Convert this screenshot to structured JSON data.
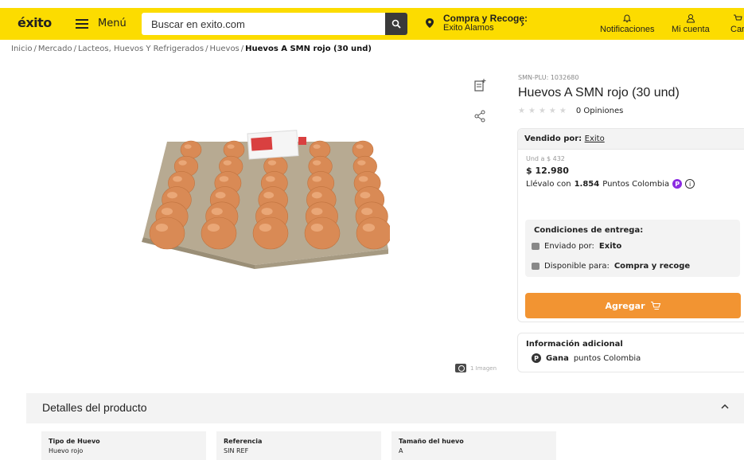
{
  "header": {
    "logo": "éxito",
    "menu_label": "Menú",
    "search_placeholder": "Buscar en exito.com",
    "pickup_title": "Compra y Recoge:",
    "pickup_store": "Exito Alamos",
    "notifications": "Notificaciones",
    "account": "Mi cuenta",
    "cart": "Car",
    "bg_color": "#fcdc00"
  },
  "breadcrumb": [
    "Inicio",
    "Mercado",
    "Lacteos, Huevos Y Refrigerados",
    "Huevos",
    "Huevos A SMN rojo (30 und)"
  ],
  "gallery": {
    "image_count": "1 Imagen"
  },
  "product": {
    "plu": "SMN-PLU: 1032680",
    "title": "Huevos A SMN rojo (30 und)",
    "rating_stars": 0,
    "opinions": "0 Opiniones",
    "seller_prefix": "Vendido por:",
    "seller": "Exito",
    "unit_price": "Und a $ 432",
    "price": "$ 12.980",
    "points_prefix": "Llévalo con",
    "points_value": "1.854",
    "points_suffix": "Puntos Colombia"
  },
  "delivery": {
    "title": "Condiciones de entrega:",
    "shipped_label": "Enviado por:",
    "shipped_value": "Exito",
    "available_label": "Disponible para:",
    "available_value": "Compra y recoge"
  },
  "add_button": "Agregar",
  "additional": {
    "title": "Información adicional",
    "gana": "Gana",
    "gana_suffix": "puntos Colombia"
  },
  "details": {
    "title": "Detalles del producto",
    "specs": [
      {
        "key": "Tipo de Huevo",
        "value": "Huevo rojo"
      },
      {
        "key": "Referencia",
        "value": "SIN REF"
      },
      {
        "key": "Tamaño del huevo",
        "value": "A"
      }
    ]
  }
}
